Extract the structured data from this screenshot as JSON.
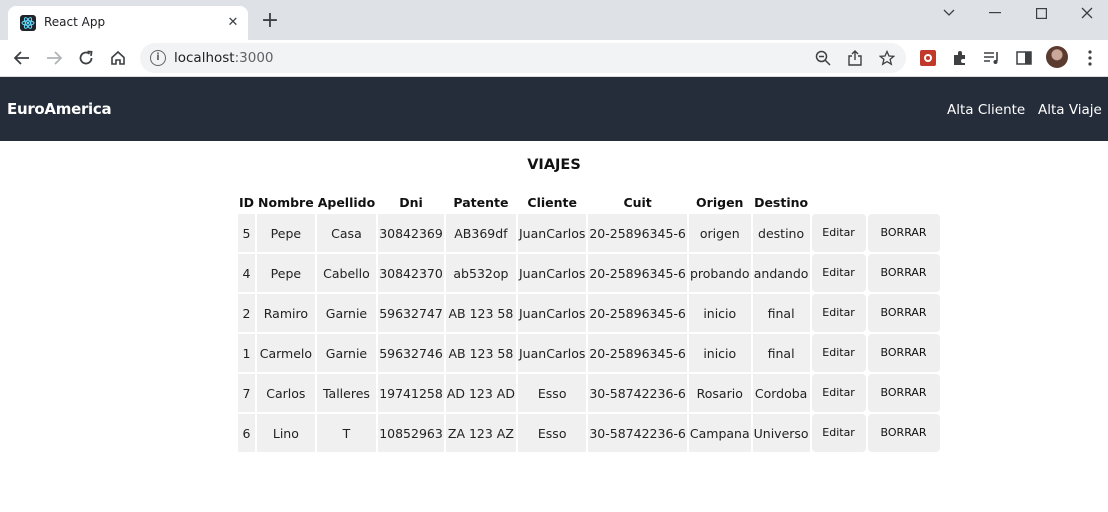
{
  "browser": {
    "tab_title": "React App",
    "tab_close": "✕",
    "new_tab": "+",
    "url_host": "localhost",
    "url_port": ":3000"
  },
  "navbar": {
    "brand": "EuroAmerica",
    "links": [
      "Alta Cliente",
      "Alta Viaje"
    ]
  },
  "page": {
    "title": "VIAJES"
  },
  "table": {
    "headers": [
      "ID",
      "Nombre",
      "Apellido",
      "Dni",
      "Patente",
      "Cliente",
      "Cuit",
      "Origen",
      "Destino"
    ],
    "edit_label": "Editar",
    "delete_label": "BORRAR",
    "rows": [
      [
        "5",
        "Pepe",
        "Casa",
        "30842369",
        "AB369df",
        "JuanCarlos",
        "20-25896345-6",
        "origen",
        "destino"
      ],
      [
        "4",
        "Pepe",
        "Cabello",
        "30842370",
        "ab532op",
        "JuanCarlos",
        "20-25896345-6",
        "probando",
        "andando"
      ],
      [
        "2",
        "Ramiro",
        "Garnie",
        "59632747",
        "AB 123 58",
        "JuanCarlos",
        "20-25896345-6",
        "inicio",
        "final"
      ],
      [
        "1",
        "Carmelo",
        "Garnie",
        "59632746",
        "AB 123 58",
        "JuanCarlos",
        "20-25896345-6",
        "inicio",
        "final"
      ],
      [
        "7",
        "Carlos",
        "Talleres",
        "19741258",
        "AD 123 AD",
        "Esso",
        "30-58742236-6",
        "Rosario",
        "Cordoba"
      ],
      [
        "6",
        "Lino",
        "T",
        "10852963",
        "ZA 123 AZ",
        "Esso",
        "30-58742236-6",
        "Campana",
        "Universo"
      ]
    ]
  },
  "colors": {
    "navbar_bg": "#252d3a",
    "cell_bg": "#f0f0f0",
    "tabstrip_bg": "#dee1e6"
  }
}
